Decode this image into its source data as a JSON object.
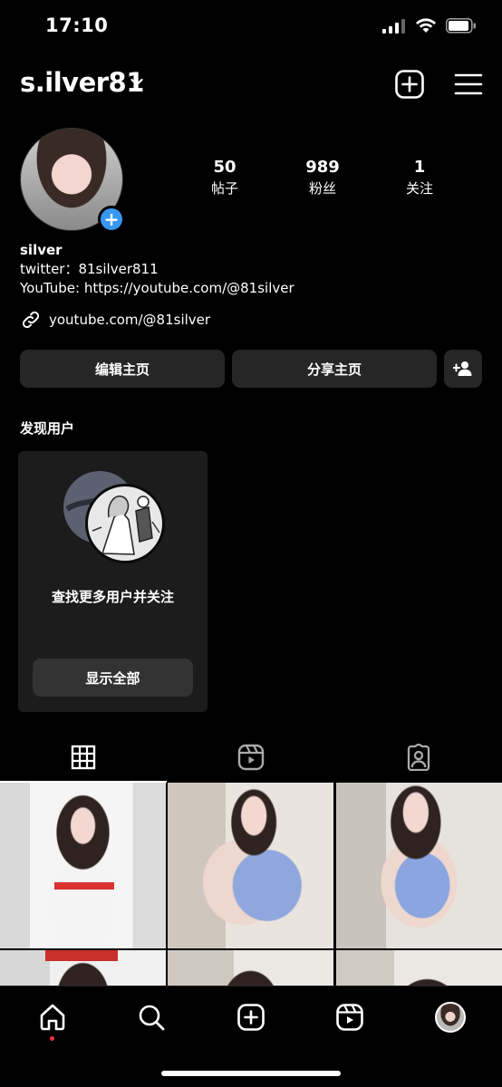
{
  "status_bar": {
    "time": "17:10"
  },
  "header": {
    "username": "s.ilver81"
  },
  "profile": {
    "stats": [
      {
        "value": "50",
        "label": "帖子"
      },
      {
        "value": "989",
        "label": "粉丝"
      },
      {
        "value": "1",
        "label": "关注"
      }
    ],
    "avatar_add": "+",
    "name": "silver",
    "bio_lines": [
      "twitter：81silver811",
      "YouTube: https://youtube.com/@81silver"
    ],
    "link": "youtube.com/@81silver"
  },
  "buttons": {
    "edit": "编辑主页",
    "share": "分享主页"
  },
  "discover": {
    "title": "发现用户",
    "card_text": "查找更多用户并关注",
    "card_button": "显示全部"
  },
  "icons": {
    "status": [
      "cellular-signal-icon",
      "wifi-icon",
      "battery-icon"
    ],
    "header": [
      "chevron-down-icon",
      "new-post-icon",
      "menu-icon"
    ],
    "tabs": [
      "grid-icon",
      "reels-icon",
      "tagged-icon"
    ],
    "nav": [
      "home-icon",
      "search-icon",
      "create-icon",
      "reels-icon",
      "profile-avatar"
    ]
  },
  "colors": {
    "accent": "#3797f0",
    "notification_dot": "#ff3040",
    "button_bg": "#262626"
  }
}
